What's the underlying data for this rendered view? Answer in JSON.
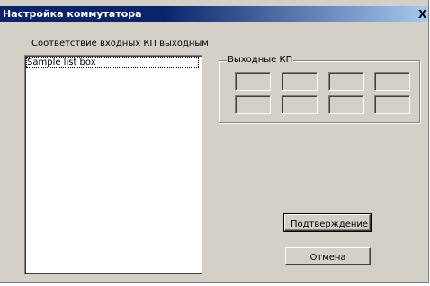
{
  "window": {
    "title": "Настройка коммутатора",
    "close_label": "X"
  },
  "main": {
    "caption": "Соответствие входных КП выходным",
    "listbox": {
      "items": [
        "Sample list box"
      ]
    },
    "output_group": {
      "title": "Выходные КП",
      "fields": [
        "",
        "",
        "",
        "",
        "",
        "",
        "",
        ""
      ]
    },
    "buttons": {
      "confirm_label": "Подтверждение",
      "cancel_label": "Отмена"
    }
  }
}
